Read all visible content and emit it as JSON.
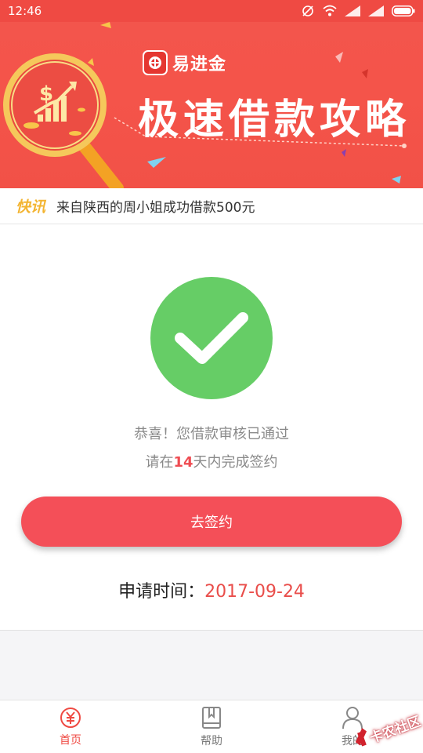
{
  "status_bar": {
    "time": "12:46"
  },
  "banner": {
    "brand_name": "易进金",
    "title": "极速借款攻略",
    "icons": [
      "magnifier-icon",
      "dollar-icon",
      "growth-chart-icon"
    ]
  },
  "ticker": {
    "tag": "快讯",
    "text": "来自陕西的周小姐成功借款500元"
  },
  "result": {
    "icon": "check-icon",
    "message_line1": "恭喜！您借款审核已通过",
    "message_line2_prefix": "请在",
    "message_line2_days": "14",
    "message_line2_suffix": "天内完成签约",
    "sign_button_label": "去签约",
    "apply_time_label": "申请时间：",
    "apply_time_value": "2017-09-24"
  },
  "bottom_nav": {
    "items": [
      {
        "label": "首页",
        "icon": "yuan-circle-icon",
        "active": true
      },
      {
        "label": "帮助",
        "icon": "book-icon",
        "active": false
      },
      {
        "label": "我的",
        "icon": "user-icon",
        "active": false
      }
    ]
  },
  "watermark": {
    "text": "卡农社区"
  },
  "colors": {
    "accent": "#ef4a43",
    "success": "#66cd66",
    "button": "#f44f58",
    "ticker_tag": "#f3b431"
  }
}
